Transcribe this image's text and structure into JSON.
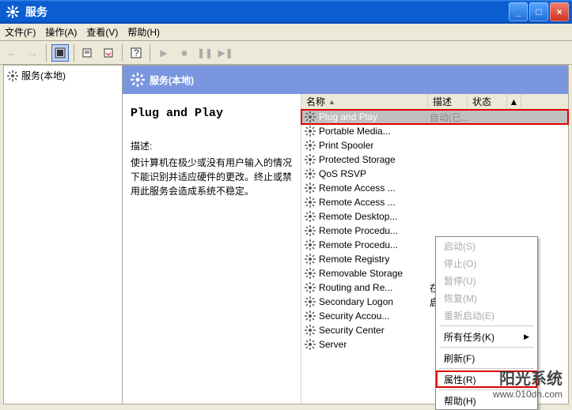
{
  "window": {
    "title": "服务",
    "min_label": "_",
    "max_label": "□",
    "close_label": "×"
  },
  "menu": {
    "file": "文件(F)",
    "action": "操作(A)",
    "view": "查看(V)",
    "help": "帮助(H)"
  },
  "tree": {
    "root": "服务(本地)"
  },
  "header": {
    "title": "服务(本地)"
  },
  "detail": {
    "name": "Plug and Play",
    "desc_label": "描述:",
    "description": "使计算机在极少或没有用户输入的情况下能识别并适应硬件的更改。终止或禁用此服务会造成系统不稳定。"
  },
  "columns": {
    "name": "名称",
    "desc": "描述",
    "status": "状态",
    "sort_icon": "▲",
    "scroll_icon": "▲"
  },
  "services": [
    {
      "name": "Plug and Play",
      "selected": true,
      "boxed": true,
      "status_hint": "自动(已..."
    },
    {
      "name": "Portable Media..."
    },
    {
      "name": "Print Spooler"
    },
    {
      "name": "Protected Storage"
    },
    {
      "name": "QoS RSVP"
    },
    {
      "name": "Remote Access ..."
    },
    {
      "name": "Remote Access ..."
    },
    {
      "name": "Remote Desktop..."
    },
    {
      "name": "Remote Procedu..."
    },
    {
      "name": "Remote Procedu..."
    },
    {
      "name": "Remote Registry"
    },
    {
      "name": "Removable Storage"
    },
    {
      "name": "Routing and Re...",
      "status": "在..."
    },
    {
      "name": "Secondary Logon",
      "status": "启..."
    },
    {
      "name": "Security Accou..."
    },
    {
      "name": "Security Center"
    },
    {
      "name": "Server"
    }
  ],
  "context_menu": {
    "start": "启动(S)",
    "stop": "停止(O)",
    "pause": "暂停(U)",
    "resume": "恢复(M)",
    "restart": "重新启动(E)",
    "all_tasks": "所有任务(K)",
    "refresh": "刷新(F)",
    "properties": "属性(R)",
    "help": "帮助(H)"
  },
  "watermark": {
    "brand": "阳光系统",
    "url": "www.010dh.com"
  }
}
